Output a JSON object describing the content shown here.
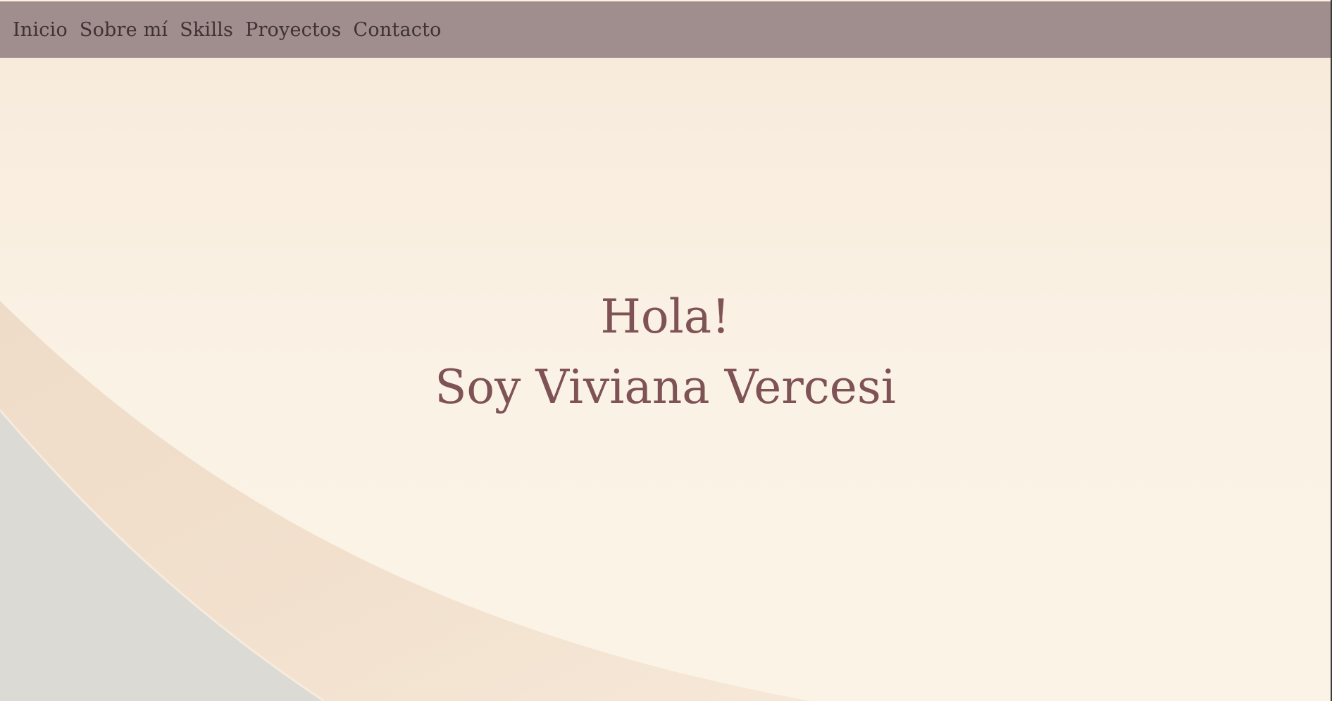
{
  "nav": {
    "items": [
      {
        "label": "Inicio"
      },
      {
        "label": "Sobre mí"
      },
      {
        "label": "Skills"
      },
      {
        "label": "Proyectos"
      },
      {
        "label": "Contacto"
      }
    ]
  },
  "hero": {
    "greeting": "Hola!",
    "intro": "Soy Viviana Vercesi"
  },
  "colors": {
    "navbar": "#a08d8d",
    "nav_text": "#3f3233",
    "hero_text": "#7f5355",
    "background": "#faf1e4"
  }
}
